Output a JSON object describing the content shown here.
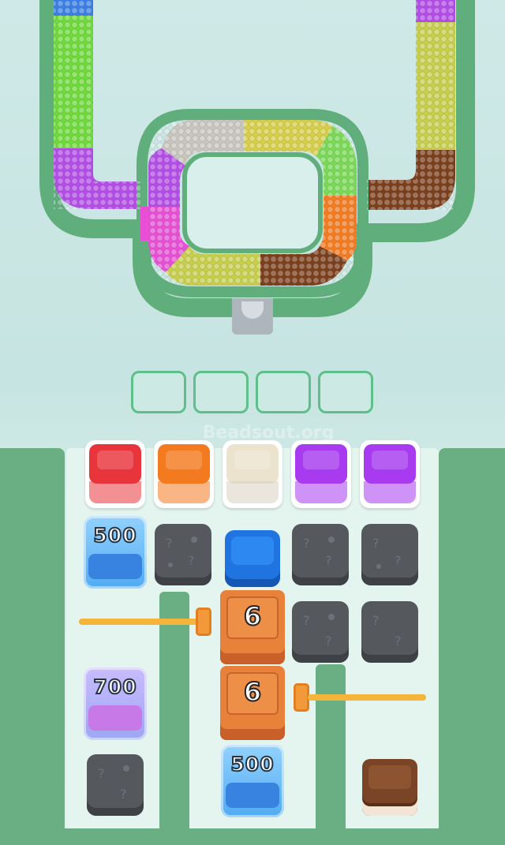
{
  "watermark": "Beadsout.org",
  "slots": {
    "count": 4
  },
  "cups": [
    {
      "name": "red-cup",
      "color": "#e8343b"
    },
    {
      "name": "orange-cup",
      "color": "#f47a1f"
    },
    {
      "name": "white-cup",
      "color": "#f1ead9"
    },
    {
      "name": "purple-cup",
      "color": "#a83bf0"
    },
    {
      "name": "purple-cup-2",
      "color": "#a83bf0"
    }
  ],
  "ice_blocks": [
    {
      "value": "500",
      "color": "#2f7de0"
    },
    {
      "value": "700",
      "color": "#c673e8"
    },
    {
      "value": "500",
      "color": "#2f7de0"
    }
  ],
  "crates": [
    {
      "value": "6"
    },
    {
      "value": "6"
    }
  ],
  "bead_colors": {
    "blue": "#3b7fe6",
    "green": "#6edb3a",
    "purple": "#b44de8",
    "magenta": "#e84fd6",
    "olive": "#c8cf4a",
    "gray": "#c9c6bf",
    "yellow": "#d8cf48",
    "lime": "#79da55",
    "brown": "#7c3f1c",
    "orange": "#f47b1f"
  }
}
